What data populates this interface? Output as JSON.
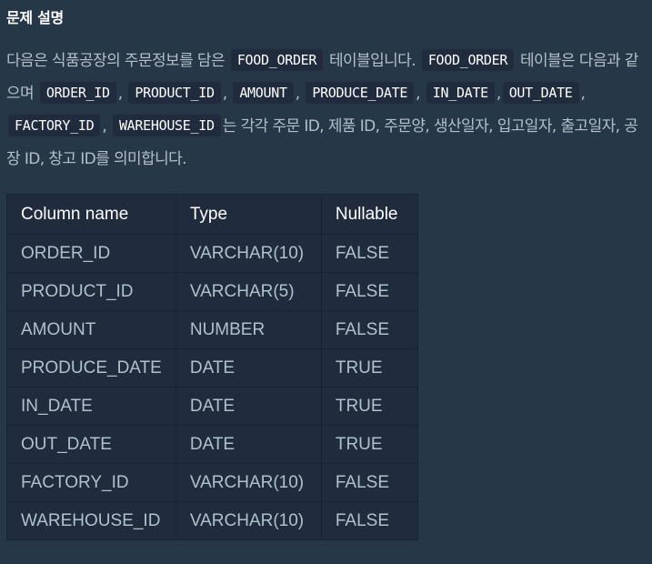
{
  "title": "문제 설명",
  "description": {
    "t1": "다음은 식품공장의 주문정보를 담은",
    "c1": "FOOD_ORDER",
    "t2": "테이블입니다.",
    "c2": "FOOD_ORDER",
    "t3": "테이블은 다음과 같으며",
    "c3": "ORDER_ID",
    "s1": ",",
    "c4": "PRODUCT_ID",
    "s2": ",",
    "c5": "AMOUNT",
    "s3": ",",
    "c6": "PRODUCE_DATE",
    "s4": ",",
    "c7": "IN_DATE",
    "s5": ",",
    "c8": "OUT_DATE",
    "s6": ",",
    "c9": "FACTORY_ID",
    "s7": ",",
    "c10": "WAREHOUSE_ID",
    "t4": "는 각각 주문 ID, 제품 ID, 주문양, 생산일자, 입고일자, 출고일자, 공장 ID, 창고 ID를 의미합니다."
  },
  "table": {
    "headers": [
      "Column name",
      "Type",
      "Nullable"
    ],
    "rows": [
      [
        "ORDER_ID",
        "VARCHAR(10)",
        "FALSE"
      ],
      [
        "PRODUCT_ID",
        "VARCHAR(5)",
        "FALSE"
      ],
      [
        "AMOUNT",
        "NUMBER",
        "FALSE"
      ],
      [
        "PRODUCE_DATE",
        "DATE",
        "TRUE"
      ],
      [
        "IN_DATE",
        "DATE",
        "TRUE"
      ],
      [
        "OUT_DATE",
        "DATE",
        "TRUE"
      ],
      [
        "FACTORY_ID",
        "VARCHAR(10)",
        "FALSE"
      ],
      [
        "WAREHOUSE_ID",
        "VARCHAR(10)",
        "FALSE"
      ]
    ]
  },
  "colors": {
    "background": "#263747",
    "text": "#b2c0cc",
    "heading": "#ffffff",
    "code_background": "#202b3d",
    "table_background": "#202b3d",
    "table_border": "#172334"
  }
}
